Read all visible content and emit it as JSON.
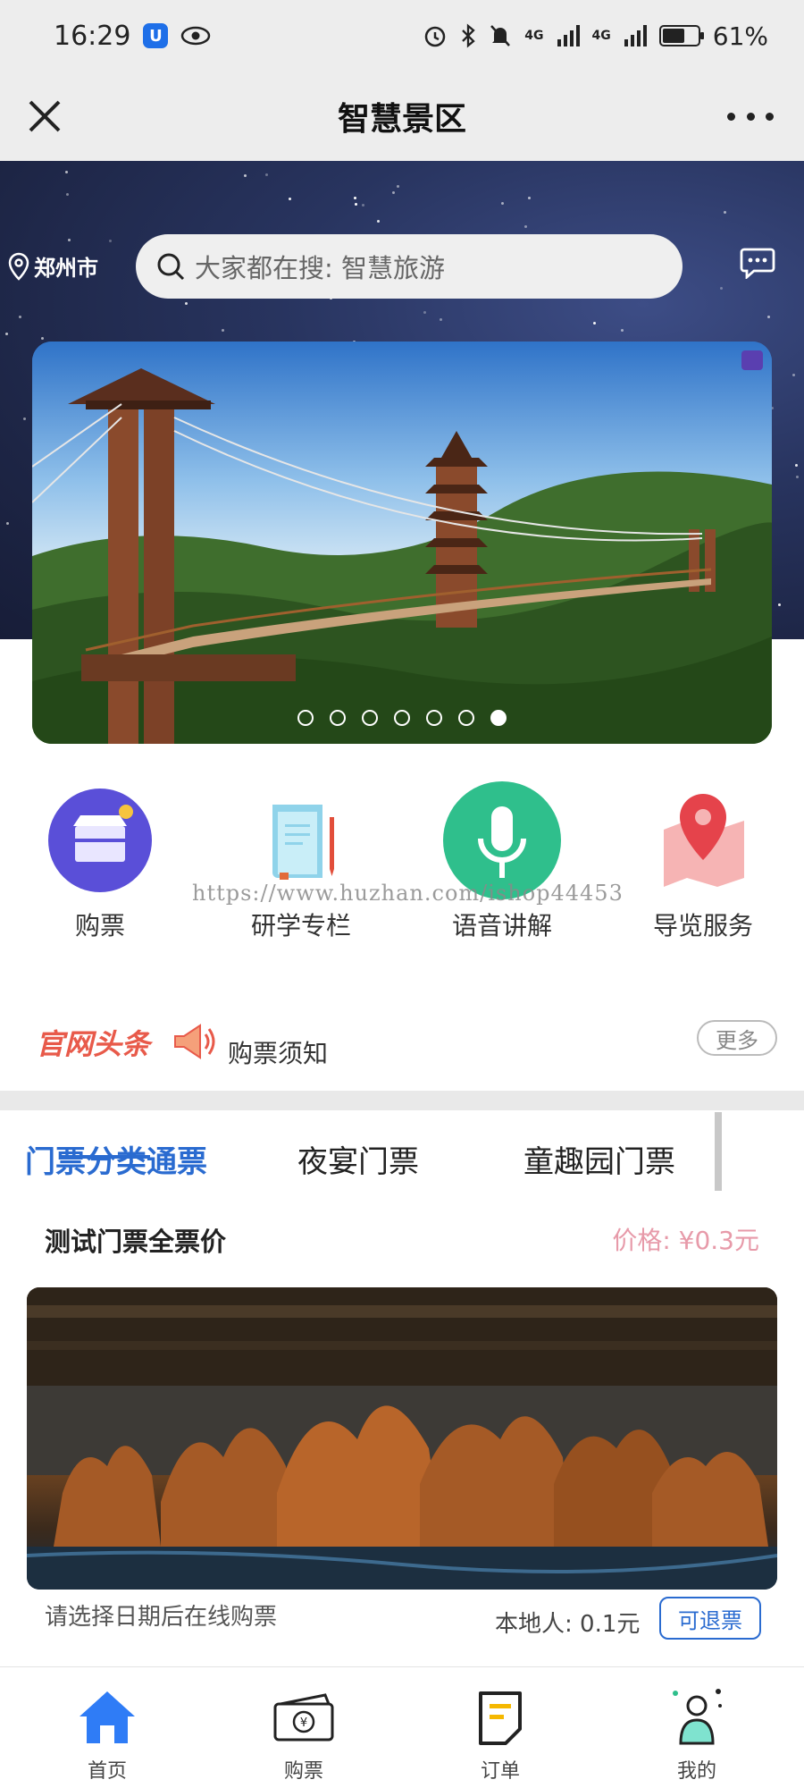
{
  "status_bar": {
    "time": "16:29",
    "signal_1": "4G",
    "signal_2": "4G",
    "battery": "61%",
    "battery_level": 0.61
  },
  "title_bar": {
    "title": "智慧景区"
  },
  "header": {
    "location": "郑州市",
    "search_placeholder": "大家都在搜: 智慧旅游"
  },
  "banner": {
    "slide_count": 7,
    "active_index": 6
  },
  "quick_menu": [
    {
      "label": "购票",
      "icon": "shop-icon"
    },
    {
      "label": "研学专栏",
      "icon": "book-icon"
    },
    {
      "label": "语音讲解",
      "icon": "microphone-icon"
    },
    {
      "label": "导览服务",
      "icon": "map-pin-icon"
    }
  ],
  "watermark": "https://www.huzhan.com/ishop44453",
  "news": {
    "brand": "官网头条",
    "headline": "购票须知",
    "more": "更多"
  },
  "tabs": [
    "门票分类通票",
    "夜宴门票",
    "童趣园门票"
  ],
  "ticket": {
    "name": "测试门票全票价",
    "price": "价格: ¥0.3元",
    "hint": "请选择日期后在线购票",
    "local_price": "本地人: 0.1元",
    "refund": "可退票"
  },
  "bottom_nav": [
    {
      "label": "首页",
      "icon": "home-icon"
    },
    {
      "label": "购票",
      "icon": "ticket-icon"
    },
    {
      "label": "订单",
      "icon": "order-icon"
    },
    {
      "label": "我的",
      "icon": "user-icon"
    }
  ],
  "colors": {
    "accent": "#2a6bd0",
    "price": "#e79aa9",
    "news_brand": "#e85a4a",
    "hero_bg": "#28345f"
  }
}
